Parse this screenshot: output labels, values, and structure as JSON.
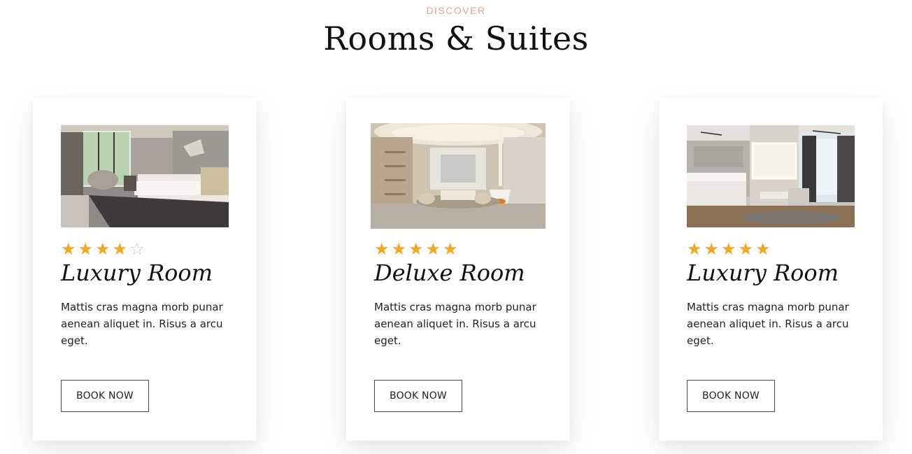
{
  "header": {
    "eyebrow": "DISCOVER",
    "title": "Rooms & Suites"
  },
  "colors": {
    "accent": "#e3a58c",
    "star_filled": "#f5a623",
    "star_empty": "#c9c9c9"
  },
  "rooms": [
    {
      "name": "Luxury Room",
      "rating": 4,
      "max_rating": 5,
      "description": "Mattis cras magna morb punar aenean aliquet in. Risus a arcu eget.",
      "button_label": "BOOK NOW",
      "image_icon": "bedroom-photo"
    },
    {
      "name": "Deluxe Room",
      "rating": 5,
      "max_rating": 5,
      "description": "Mattis cras magna morb punar aenean aliquet in. Risus a arcu eget.",
      "button_label": "BOOK NOW",
      "image_icon": "lounge-photo"
    },
    {
      "name": "Luxury Room",
      "rating": 5,
      "max_rating": 5,
      "description": "Mattis cras magna morb punar aenean aliquet in. Risus a arcu eget.",
      "button_label": "BOOK NOW",
      "image_icon": "suite-photo"
    }
  ]
}
